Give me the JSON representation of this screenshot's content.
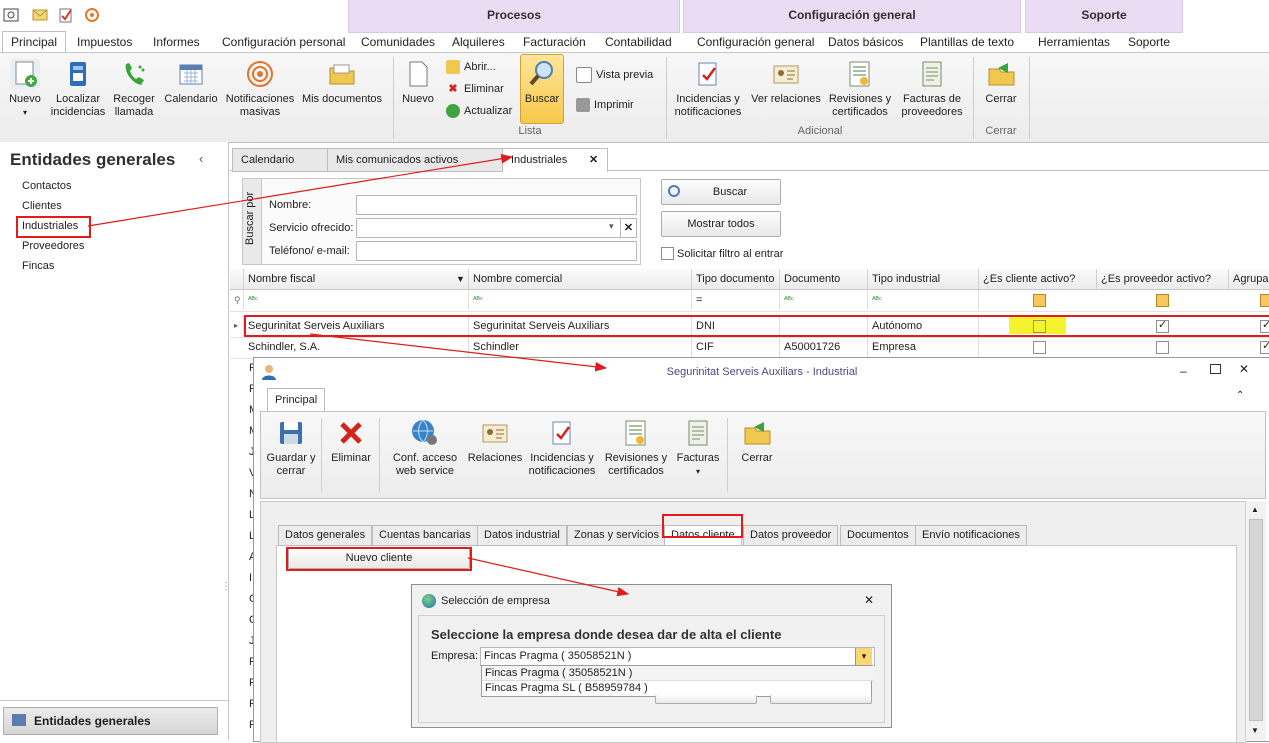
{
  "contextual_groups": {
    "procesos": "Procesos",
    "configuracion": "Configuración general",
    "soporte": "Soporte"
  },
  "ribbon_tabs": [
    "Principal",
    "Impuestos",
    "Informes",
    "Configuración personal",
    "Comunidades",
    "Alquileres",
    "Facturación",
    "Contabilidad",
    "Configuración general",
    "Datos básicos",
    "Plantillas de texto",
    "Herramientas",
    "Soporte"
  ],
  "ribbon": {
    "nuevo": "Nuevo",
    "localizar": "Localizar incidencias",
    "recoger": "Recoger llamada",
    "calendario": "Calendario",
    "notificaciones": "Notificaciones masivas",
    "mis_documentos": "Mis documentos",
    "lista_nuevo": "Nuevo",
    "abrir": "Abrir...",
    "eliminar": "Eliminar",
    "actualizar": "Actualizar",
    "buscar": "Buscar",
    "vista_previa": "Vista previa",
    "imprimir": "Imprimir",
    "lista_label": "Lista",
    "incidencias": "Incidencias y notificaciones",
    "ver_relaciones": "Ver relaciones",
    "revisiones": "Revisiones y certificados",
    "facturas": "Facturas de proveedores",
    "adicional_label": "Adicional",
    "cerrar": "Cerrar",
    "cerrar_label": "Cerrar"
  },
  "sidebar": {
    "title": "Entidades generales",
    "items": [
      "Contactos",
      "Clientes",
      "Industriales",
      "Proveedores",
      "Fincas"
    ],
    "footer": "Entidades generales"
  },
  "doc_tabs": [
    "Calendario",
    "Mis comunicados activos",
    "Industriales"
  ],
  "search": {
    "group_label": "Buscar por",
    "nombre": "Nombre:",
    "servicio": "Servicio ofrecido:",
    "telefono": "Teléfono/ e-mail:",
    "buscar": "Buscar",
    "mostrar_todos": "Mostrar todos",
    "solicitar": "Solicitar filtro al entrar"
  },
  "grid": {
    "columns": [
      "Nombre fiscal",
      "Nombre comercial",
      "Tipo documento",
      "Documento",
      "Tipo industrial",
      "¿Es cliente activo?",
      "¿Es proveedor activo?",
      "Agrupa"
    ],
    "filter_eq": "=",
    "rows": [
      {
        "nombre_fiscal": "Segurinitat Serveis Auxiliars",
        "nombre_comercial": "Segurinitat Serveis Auxiliars",
        "tipo_doc": "DNI",
        "documento": "",
        "tipo_industrial": "Autónomo",
        "cliente": false,
        "proveedor": true
      },
      {
        "nombre_fiscal": "Schindler, S.A.",
        "nombre_comercial": "Schindler",
        "tipo_doc": "CIF",
        "documento": "A50001726",
        "tipo_industrial": "Empresa",
        "cliente": false,
        "proveedor": false
      }
    ],
    "partial_rows": [
      "F",
      "F",
      "M",
      "M",
      "J",
      "V",
      "N",
      "L",
      "L",
      "A",
      "I",
      "C",
      "C",
      "J",
      "F",
      "F",
      "F",
      "F"
    ]
  },
  "window": {
    "title": "Segurinitat Serveis Auxiliars - Industrial",
    "tab": "Principal",
    "guardar": "Guardar y cerrar",
    "eliminar": "Eliminar",
    "conf": "Conf. acceso web service",
    "relaciones": "Relaciones",
    "incidencias": "Incidencias y notificaciones",
    "revisiones": "Revisiones y certificados",
    "facturas": "Facturas",
    "cerrar": "Cerrar",
    "subtabs": [
      "Datos generales",
      "Cuentas bancarias",
      "Datos industrial",
      "Zonas y servicios",
      "Datos cliente",
      "Datos proveedor",
      "Documentos",
      "Envío notificaciones"
    ],
    "nuevo_cliente": "Nuevo cliente"
  },
  "dialog": {
    "title": "Selección de empresa",
    "heading": "Seleccione la empresa donde desea dar de alta el cliente",
    "empresa_label": "Empresa:",
    "selected": "Fincas Pragma ( 35058521N )",
    "options": [
      "Fincas Pragma ( 35058521N )",
      "Fincas Pragma SL ( B58959784 )"
    ]
  },
  "colors": {
    "accent_red": "#e01c1c",
    "contextual_tab": "#eadcf3",
    "highlight_yellow": "#f4f32e"
  }
}
